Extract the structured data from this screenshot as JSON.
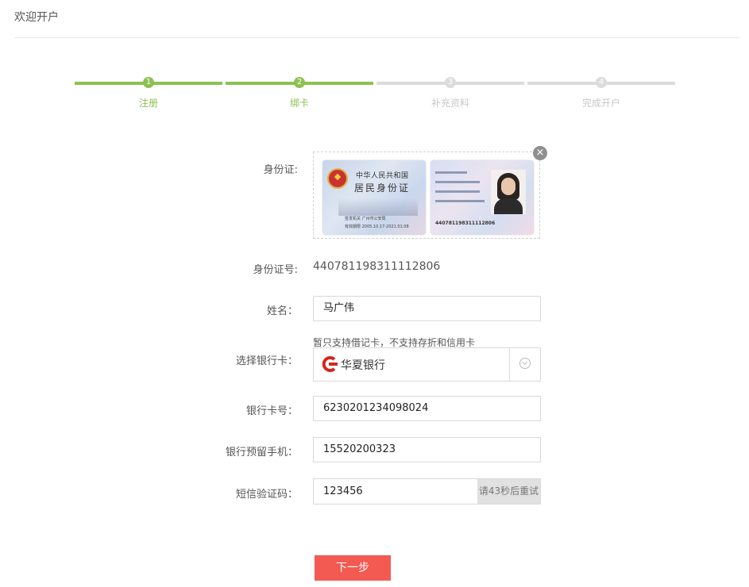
{
  "page": {
    "title": "欢迎开户"
  },
  "steps": [
    {
      "num": "1",
      "label": "注册",
      "active": true
    },
    {
      "num": "2",
      "label": "绑卡",
      "active": true
    },
    {
      "num": "3",
      "label": "补充资料",
      "active": false
    },
    {
      "num": "4",
      "label": "完成开户",
      "active": false
    }
  ],
  "form": {
    "id_card_label": "身份证:",
    "id_card": {
      "front_line1": "中华人民共和国",
      "front_line2": "居民身份证",
      "front_authority": "签发机关  广州市公安局",
      "front_validity": "有效期限  2005.10.17-2021.01.08",
      "back_number": "440781198311112806"
    },
    "id_number_label": "身份证号:",
    "id_number_value": "440781198311112806",
    "name_label": "姓名：",
    "name_value": "马广伟",
    "bank_hint": "暂只支持借记卡，不支持存折和信用卡",
    "bank_label": "选择银行卡：",
    "bank_name": "华夏银行",
    "card_number_label": "银行卡号：",
    "card_number_value": "6230201234098024",
    "phone_label": "银行预留手机：",
    "phone_value": "15520200323",
    "sms_label": "短信验证码：",
    "sms_value": "123456",
    "retry_text": "请43秒后重试"
  },
  "next_button": "下一步",
  "colors": {
    "accent": "#8cc152",
    "primary_button": "#f35a52",
    "bank_logo": "#d2281f"
  }
}
